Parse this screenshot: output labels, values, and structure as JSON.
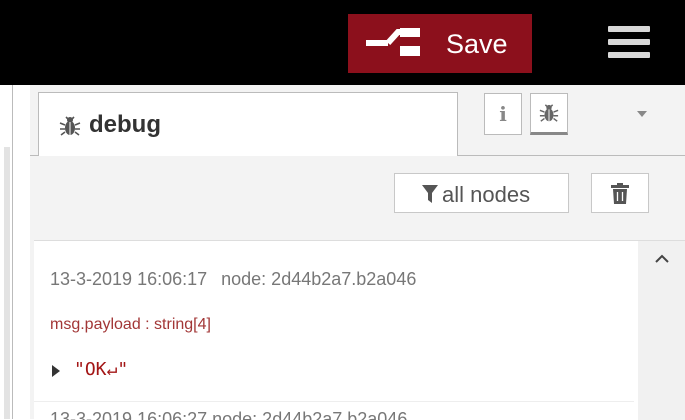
{
  "header": {
    "deploy_label": "Save",
    "deploy_color": "#8c101c",
    "deploy_icon": "deploy-icon",
    "menu_icon": "hamburger-menu-icon"
  },
  "sidebar": {
    "tab": {
      "label": "debug",
      "icon": "bug-icon"
    },
    "tab_buttons": {
      "info_glyph": "i",
      "info_icon": "info-icon",
      "debug_icon": "bug-icon",
      "dropdown_icon": "caret-down-icon"
    },
    "toolbar": {
      "filter_label": "all nodes",
      "filter_icon": "funnel-icon",
      "clear_icon": "trash-icon"
    },
    "messages": [
      {
        "timestamp": "13-3-2019 16:06:17",
        "node": "node: 2d44b2a7.b2a046",
        "topic": "msg.payload : string[4]",
        "value": "\"OK↵\""
      }
    ],
    "next_message_partial": "13-3-2019 16:06:27    node: 2d44b2a7.b2a046"
  }
}
